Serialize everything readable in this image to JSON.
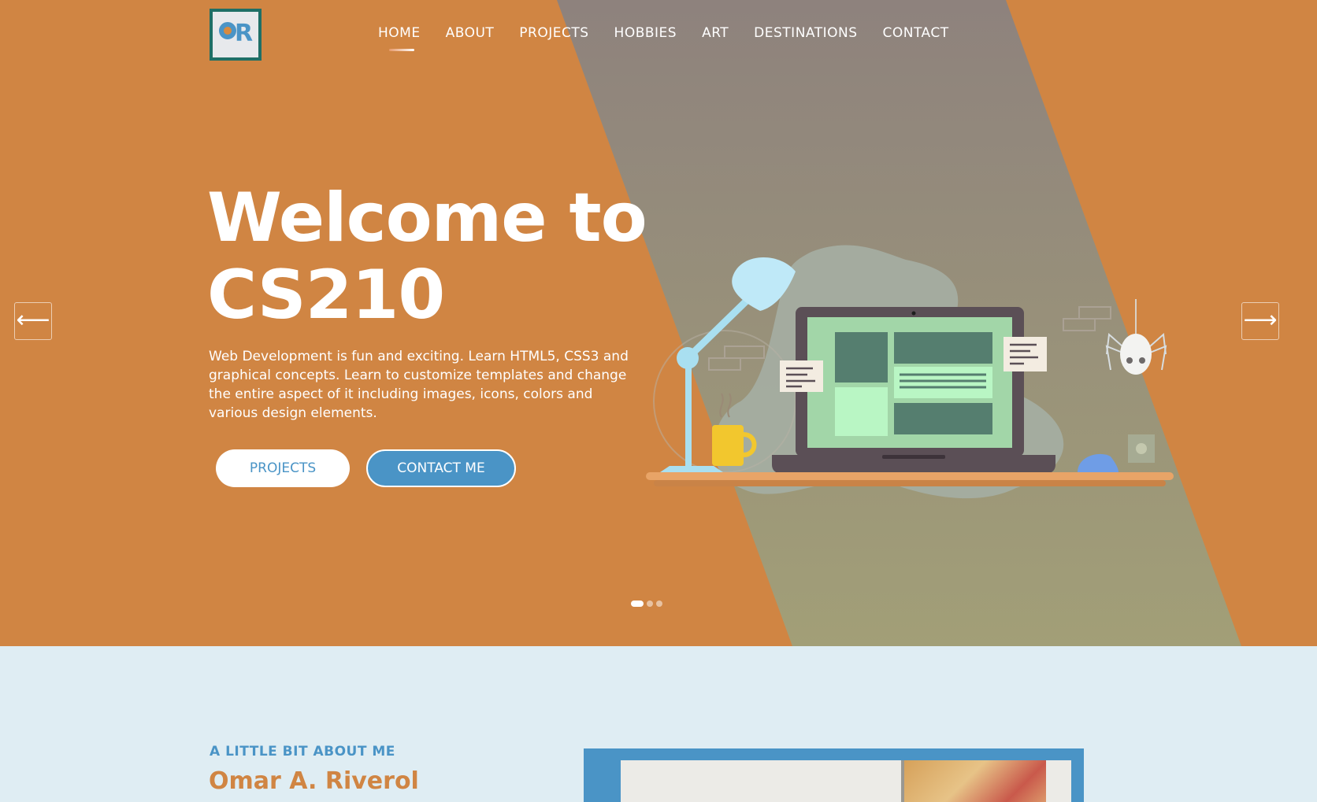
{
  "colors": {
    "hero_bg": "#d08543",
    "beam": "#90837c",
    "accent_blue": "#4a94c6",
    "section_bg": "#dfedf3",
    "white": "#ffffff"
  },
  "logo": {
    "alt": "OR"
  },
  "nav": {
    "items": [
      {
        "label": "HOME",
        "active": true
      },
      {
        "label": "ABOUT"
      },
      {
        "label": "PROJECTS"
      },
      {
        "label": "HOBBIES"
      },
      {
        "label": "ART"
      },
      {
        "label": "DESTINATIONS"
      },
      {
        "label": "CONTACT"
      }
    ]
  },
  "hero": {
    "title_line1": "Welcome to",
    "title_line2": "CS210",
    "description": "Web Development is fun and exciting. Learn HTML5, CSS3 and graphical concepts. Learn to customize templates and change the entire aspect of it including images, icons, colors and various design elements.",
    "primary_button": "PROJECTS",
    "secondary_button": "CONTACT ME",
    "prev_arrow": "⟵",
    "next_arrow": "⟶",
    "slides": 3,
    "active_slide": 1
  },
  "about": {
    "eyebrow": "A LITTLE BIT ABOUT ME",
    "name": "Omar A. Riverol"
  }
}
